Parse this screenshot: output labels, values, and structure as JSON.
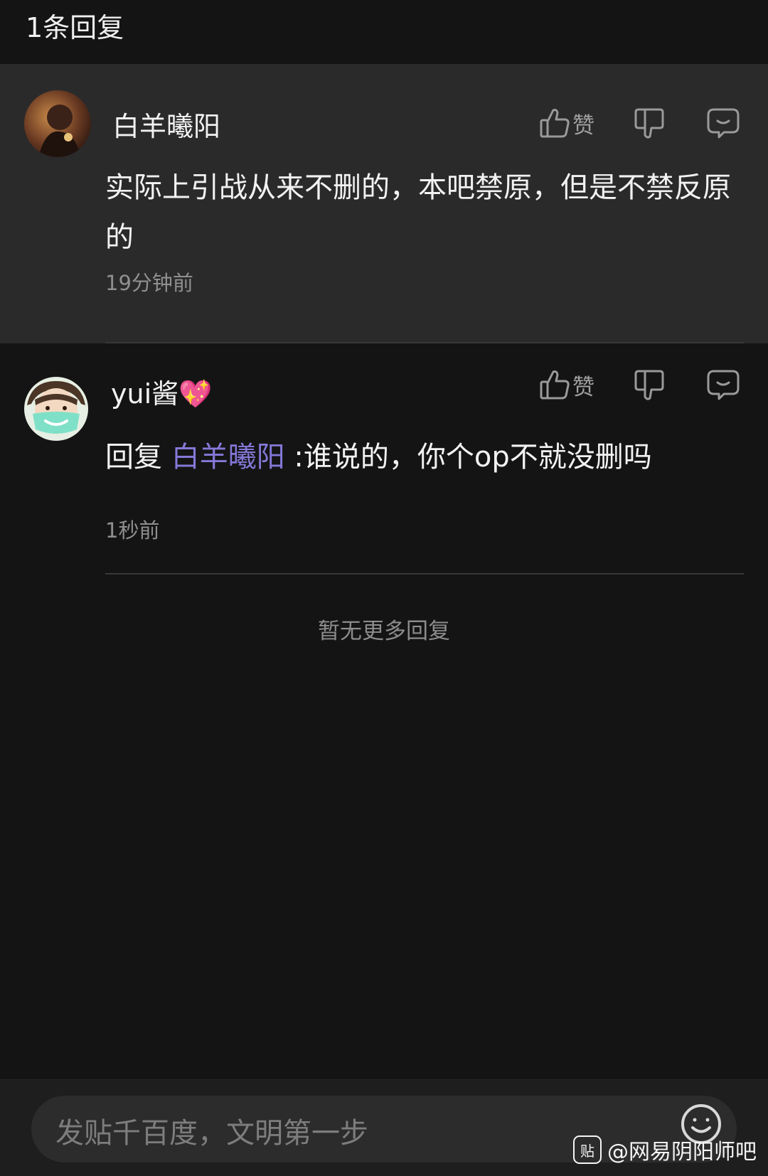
{
  "header": {
    "title": "1条回复"
  },
  "main_comment": {
    "username": "白羊曦阳",
    "like_label": "赞",
    "content": "实际上引战从来不删的，本吧禁原，但是不禁反原的",
    "time": "19分钟前"
  },
  "reply": {
    "username": "yui酱",
    "badge_emoji": "💖",
    "like_label": "赞",
    "reply_prefix": "回复 ",
    "mention": "白羊曦阳",
    "content": " :谁说的，你个op不就没删吗",
    "time": "1秒前"
  },
  "no_more": "暂无更多回复",
  "composer": {
    "placeholder": "发贴千百度，文明第一步"
  },
  "watermark": {
    "logo": "贴",
    "text": "@网易阴阳师吧"
  },
  "colors": {
    "mention": "#8478d8",
    "background": "#141414",
    "main_comment_bg": "#2a2a2b"
  }
}
